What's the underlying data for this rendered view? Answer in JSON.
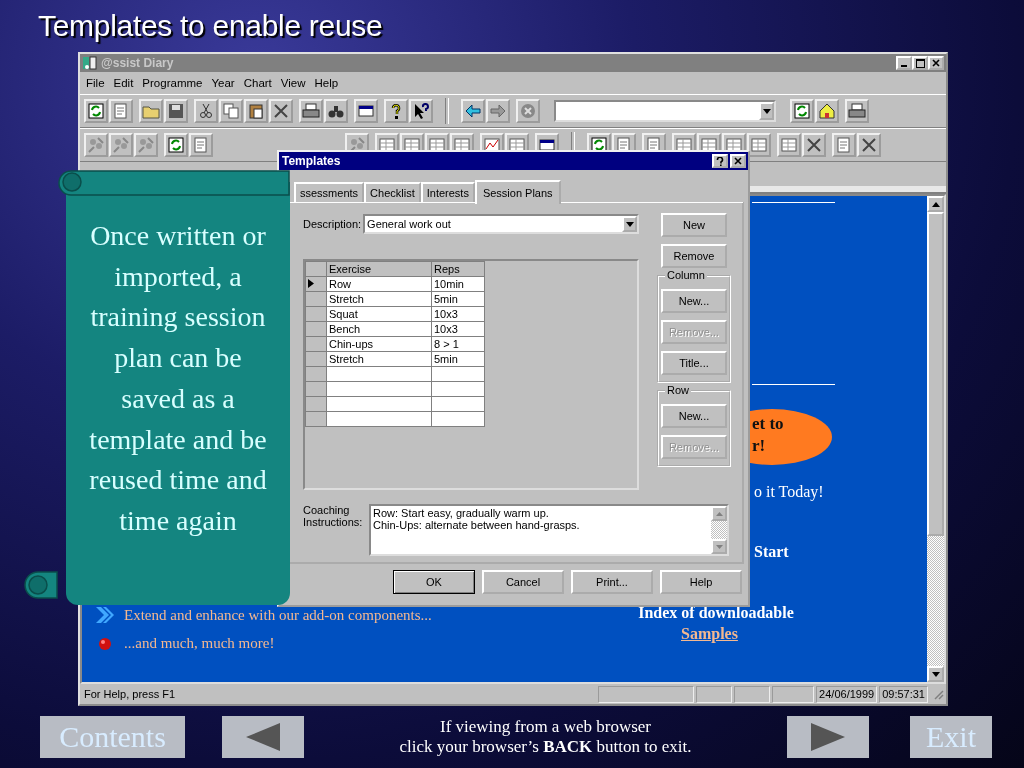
{
  "slide": {
    "title": "Templates to enable reuse"
  },
  "window": {
    "title": "@ssist Diary",
    "menu": [
      "File",
      "Edit",
      "Programme",
      "Year",
      "Chart",
      "View",
      "Help"
    ]
  },
  "page": {
    "bullets": [
      {
        "kind": "chevron",
        "text": "Extend and enhance with our add-on components..."
      },
      {
        "kind": "dot",
        "text": "...and much, much more!"
      }
    ],
    "badge_lines": [
      "et to",
      "r!"
    ],
    "today": "o it Today!",
    "start": "Start",
    "index": "Index of downloadable",
    "samples_link": "Samples"
  },
  "status_bar": {
    "help": "For Help, press F1",
    "date": "24/06/1999",
    "time": "09:57:31"
  },
  "dialog": {
    "title": "Templates",
    "tabs": [
      {
        "label": "ssessments",
        "selected": false
      },
      {
        "label": "Checklist",
        "selected": false
      },
      {
        "label": "Interests",
        "selected": false
      },
      {
        "label": "Session Plans",
        "selected": true
      }
    ],
    "description": {
      "label": "Description:",
      "value": "General work out"
    },
    "columns": [
      "Exercise",
      "Reps"
    ],
    "rows": [
      {
        "cells": [
          "Row",
          "10min"
        ],
        "selected": true
      },
      {
        "cells": [
          "Stretch",
          "5min"
        ],
        "selected": false
      },
      {
        "cells": [
          "Squat",
          "10x3"
        ],
        "selected": false
      },
      {
        "cells": [
          "Bench",
          "10x3"
        ],
        "selected": false
      },
      {
        "cells": [
          "Chin-ups",
          "8 > 1"
        ],
        "selected": false
      },
      {
        "cells": [
          "Stretch",
          "5min"
        ],
        "selected": false
      }
    ],
    "buttons": [
      {
        "label": "New",
        "disabled": false
      },
      {
        "label": "Remove",
        "disabled": false
      }
    ],
    "column_group": {
      "label": "Column",
      "buttons": [
        {
          "label": "New...",
          "disabled": false
        },
        {
          "label": "Remove...",
          "disabled": true
        },
        {
          "label": "Title...",
          "disabled": false
        }
      ]
    },
    "row_group": {
      "label": "Row",
      "buttons": [
        {
          "label": "New...",
          "disabled": false
        },
        {
          "label": "Remove...",
          "disabled": true
        }
      ]
    },
    "coaching": {
      "label": "Coaching Instructions:",
      "lines": [
        "Row: Start easy, gradually warm up.",
        "Chin-Ups: alternate between hand-grasps."
      ]
    },
    "footer_buttons": [
      {
        "label": "OK",
        "default": true
      },
      {
        "label": "Cancel",
        "default": false
      },
      {
        "label": "Print...",
        "default": false
      },
      {
        "label": "Help",
        "default": false
      }
    ]
  },
  "callout": {
    "text": "Once written or imported, a training session plan can be saved as a template and be reused time and time again"
  },
  "nav": {
    "contents": "Contents",
    "note_lines": [
      "If viewing from a web browser",
      "click your browser’s  **BACK**  button to exit."
    ],
    "exit": "Exit"
  }
}
